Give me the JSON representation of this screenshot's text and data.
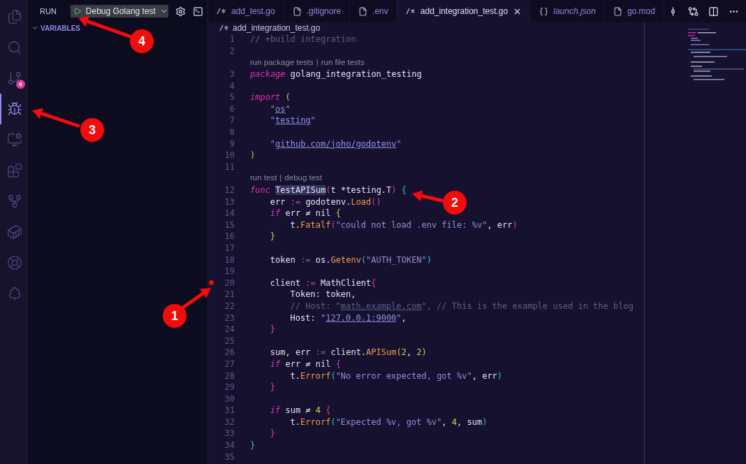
{
  "activity_bar": [
    {
      "kind": "files",
      "selected": false
    },
    {
      "kind": "search",
      "selected": false
    },
    {
      "kind": "source-control",
      "selected": false,
      "badge": "8"
    },
    {
      "kind": "run-debug",
      "selected": true
    },
    {
      "kind": "remote",
      "selected": false
    },
    {
      "kind": "extensions",
      "selected": false
    },
    {
      "kind": "git-graph",
      "selected": false
    },
    {
      "kind": "docker",
      "selected": false
    },
    {
      "kind": "kubernetes",
      "selected": false
    },
    {
      "kind": "tree",
      "selected": false
    }
  ],
  "sidebar": {
    "title": "RUN",
    "config": "Debug Golang test",
    "section": {
      "label": "VARIABLES",
      "expanded": true
    }
  },
  "tabs": [
    {
      "label": "add_test.go",
      "kind": "go",
      "selected": false,
      "preview": false
    },
    {
      "label": ".gitignore",
      "kind": "file",
      "selected": false,
      "preview": false
    },
    {
      "label": ".env",
      "kind": "file",
      "selected": false,
      "preview": false
    },
    {
      "label": "add_integration_test.go",
      "kind": "go",
      "selected": true,
      "preview": false
    },
    {
      "label": "launch.json",
      "kind": "json",
      "selected": false,
      "preview": true
    },
    {
      "label": "go.mod",
      "kind": "file",
      "selected": false,
      "preview": false
    }
  ],
  "breadcrumb": "add_integration_test.go",
  "lens_separator": "|",
  "lines": [
    {
      "number": "1",
      "tokens": [
        {
          "text": "// +build integration",
          "kind": "comment"
        }
      ]
    },
    {
      "number": "2"
    },
    {
      "lens": [
        "run package tests",
        "run file tests"
      ]
    },
    {
      "number": "3",
      "tokens": [
        {
          "text": "package ",
          "kind": "kw"
        },
        {
          "text": "golang_integration_testing",
          "kind": "plain"
        }
      ]
    },
    {
      "number": "4"
    },
    {
      "number": "5",
      "tokens": [
        {
          "text": "import ",
          "kind": "kw"
        },
        {
          "text": "(",
          "kind": "b1"
        }
      ],
      "children": [
        {
          "number": "6",
          "tokens": [
            {
              "text": "\"",
              "kind": "str"
            },
            {
              "text": "os",
              "kind": "link"
            },
            {
              "text": "\"",
              "kind": "str"
            }
          ]
        },
        {
          "number": "7",
          "tokens": [
            {
              "text": "\"",
              "kind": "str"
            },
            {
              "text": "testing",
              "kind": "link"
            },
            {
              "text": "\"",
              "kind": "str"
            }
          ]
        },
        {
          "number": "8"
        },
        {
          "number": "9",
          "tokens": [
            {
              "text": "\"",
              "kind": "str"
            },
            {
              "text": "github.com/joho/godotenv",
              "kind": "link"
            },
            {
              "text": "\"",
              "kind": "str"
            }
          ]
        }
      ]
    },
    {
      "number": "10",
      "tokens": [
        {
          "text": ")",
          "kind": "b1"
        }
      ]
    },
    {
      "number": "11"
    },
    {
      "lens": [
        "run test",
        "debug test"
      ]
    },
    {
      "number": "12",
      "tokens": [
        {
          "text": "func ",
          "kind": "kw"
        },
        {
          "text": "TestAPISum",
          "kind": "hl"
        },
        {
          "text": "(",
          "kind": "b2"
        },
        {
          "text": "t *testing.T",
          "kind": "plain"
        },
        {
          "text": ")",
          "kind": "b2"
        },
        {
          "text": " {",
          "kind": "b3"
        }
      ],
      "children": [
        {
          "number": "13",
          "tokens": [
            {
              "text": "err ",
              "kind": "plain"
            },
            {
              "text": ":=",
              "kind": "op"
            },
            {
              "text": " godotenv.",
              "kind": "plain"
            },
            {
              "text": "Load",
              "kind": "fn"
            },
            {
              "text": "()",
              "kind": "b2"
            }
          ]
        },
        {
          "number": "14",
          "tokens": [
            {
              "text": "if",
              "kind": "kw"
            },
            {
              "text": " err ≠ nil ",
              "kind": "plain"
            },
            {
              "text": "{",
              "kind": "b1"
            }
          ],
          "children": [
            {
              "number": "15",
              "tokens": [
                {
                  "text": "t.",
                  "kind": "plain"
                },
                {
                  "text": "Fatalf",
                  "kind": "fn"
                },
                {
                  "text": "(",
                  "kind": "b2"
                },
                {
                  "text": "\"could not load .env file: %v\"",
                  "kind": "str"
                },
                {
                  "text": ", err",
                  "kind": "plain"
                },
                {
                  "text": ")",
                  "kind": "b2"
                }
              ]
            }
          ]
        },
        {
          "number": "16",
          "tokens": [
            {
              "text": "}",
              "kind": "b1"
            }
          ]
        },
        {
          "number": "17"
        },
        {
          "number": "18",
          "tokens": [
            {
              "text": "token ",
              "kind": "plain"
            },
            {
              "text": ":=",
              "kind": "op"
            },
            {
              "text": " os.",
              "kind": "plain"
            },
            {
              "text": "Getenv",
              "kind": "fn"
            },
            {
              "text": "(",
              "kind": "b3"
            },
            {
              "text": "\"AUTH_TOKEN\"",
              "kind": "str"
            },
            {
              "text": ")",
              "kind": "b3"
            }
          ]
        },
        {
          "number": "19"
        },
        {
          "number": "20",
          "breakpoint": true,
          "tokens": [
            {
              "text": "client ",
              "kind": "plain"
            },
            {
              "text": ":=",
              "kind": "op"
            },
            {
              "text": " MathClient",
              "kind": "plain"
            },
            {
              "text": "{",
              "kind": "b2"
            }
          ],
          "children": [
            {
              "number": "21",
              "tokens": [
                {
                  "text": "Token: token,",
                  "kind": "plain"
                }
              ]
            },
            {
              "number": "22",
              "tokens": [
                {
                  "text": "// Host: \"",
                  "kind": "comment"
                },
                {
                  "text": "math.example.com",
                  "kind": "clink"
                },
                {
                  "text": "\", // This is the example used in the blog",
                  "kind": "comment"
                }
              ]
            },
            {
              "number": "23",
              "tokens": [
                {
                  "text": "Host: ",
                  "kind": "plain"
                },
                {
                  "text": "\"",
                  "kind": "str"
                },
                {
                  "text": "127.0.0.1:9000",
                  "kind": "link"
                },
                {
                  "text": "\"",
                  "kind": "str"
                },
                {
                  "text": ",",
                  "kind": "plain"
                }
              ]
            }
          ]
        },
        {
          "number": "24",
          "tokens": [
            {
              "text": "}",
              "kind": "b2"
            }
          ]
        },
        {
          "number": "25"
        },
        {
          "number": "26",
          "tokens": [
            {
              "text": "sum, err ",
              "kind": "plain"
            },
            {
              "text": ":=",
              "kind": "op"
            },
            {
              "text": " client.",
              "kind": "plain"
            },
            {
              "text": "APISum",
              "kind": "fn"
            },
            {
              "text": "(",
              "kind": "b1"
            },
            {
              "text": "2",
              "kind": "num"
            },
            {
              "text": ", ",
              "kind": "plain"
            },
            {
              "text": "2",
              "kind": "num"
            },
            {
              "text": ")",
              "kind": "b1"
            }
          ]
        },
        {
          "number": "27",
          "tokens": [
            {
              "text": "if",
              "kind": "kw"
            },
            {
              "text": " err ≠ nil ",
              "kind": "plain"
            },
            {
              "text": "{",
              "kind": "b2"
            }
          ],
          "children": [
            {
              "number": "28",
              "tokens": [
                {
                  "text": "t.",
                  "kind": "plain"
                },
                {
                  "text": "Errorf",
                  "kind": "fn"
                },
                {
                  "text": "(",
                  "kind": "b3"
                },
                {
                  "text": "\"No error expected, got %v\"",
                  "kind": "str"
                },
                {
                  "text": ", err",
                  "kind": "plain"
                },
                {
                  "text": ")",
                  "kind": "b3"
                }
              ]
            }
          ]
        },
        {
          "number": "29",
          "tokens": [
            {
              "text": "}",
              "kind": "b2"
            }
          ]
        },
        {
          "number": "30"
        },
        {
          "number": "31",
          "tokens": [
            {
              "text": "if",
              "kind": "kw"
            },
            {
              "text": " sum ≠ ",
              "kind": "plain"
            },
            {
              "text": "4",
              "kind": "num"
            },
            {
              "text": " {",
              "kind": "b2"
            }
          ],
          "children": [
            {
              "number": "32",
              "tokens": [
                {
                  "text": "t.",
                  "kind": "plain"
                },
                {
                  "text": "Errorf",
                  "kind": "fn"
                },
                {
                  "text": "(",
                  "kind": "b3"
                },
                {
                  "text": "\"Expected %v, got %v\"",
                  "kind": "str"
                },
                {
                  "text": ", ",
                  "kind": "plain"
                },
                {
                  "text": "4",
                  "kind": "num"
                },
                {
                  "text": ", sum",
                  "kind": "plain"
                },
                {
                  "text": ")",
                  "kind": "b3"
                }
              ]
            }
          ]
        },
        {
          "number": "33",
          "tokens": [
            {
              "text": "}",
              "kind": "b2"
            }
          ]
        }
      ]
    },
    {
      "number": "34",
      "tokens": [
        {
          "text": "}",
          "kind": "b3"
        }
      ]
    },
    {
      "number": "35"
    }
  ],
  "annotations": [
    {
      "label": "1"
    },
    {
      "label": "2"
    },
    {
      "label": "3"
    },
    {
      "label": "4"
    }
  ]
}
